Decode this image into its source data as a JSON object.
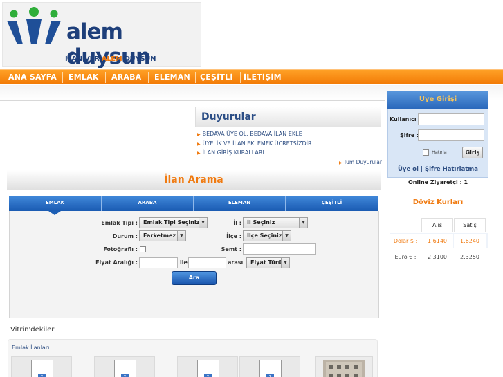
{
  "logo": {
    "word1": "alem",
    "word2": "duysun",
    "tagline_prefix": "ILAN VER ",
    "tagline_accent": "ALEM",
    "tagline_suffix": " DUYSUN"
  },
  "nav": [
    "ANA SAYFA",
    "EMLAK",
    "ARABA",
    "ELEMAN",
    "ÇEŞİTLİ",
    "İLETİŞİM"
  ],
  "announcements": {
    "title": "Duyurular",
    "items": [
      "BEDAVA ÜYE OL, BEDAVA İLAN EKLE",
      "ÜYELİK VE İLAN EKLEMEK ÜCRETSİZDİR...",
      "İLAN GİRİŞ KURALLARI"
    ],
    "all_link": "Tüm Duyurular"
  },
  "search": {
    "title": "İlan Arama",
    "tabs": [
      "EMLAK",
      "ARABA",
      "ELEMAN",
      "ÇEŞİTLİ"
    ],
    "active_tab": "EMLAK",
    "labels": {
      "emlak_tipi": "Emlak Tipi :",
      "durum": "Durum :",
      "fotografli": "Fotoğraflı :",
      "fiyat": "Fiyat Aralığı :",
      "il": "İl :",
      "ilce": "İlçe :",
      "semt": "Semt :",
      "ile": "ile",
      "arasi": "arası"
    },
    "values": {
      "emlak_tipi": "Emlak Tipi Seçiniz",
      "durum": "Farketmez",
      "il": "İl Seçiniz",
      "ilce": "İlçe Seçiniz",
      "fiyat_turu": "Fiyat Türü"
    },
    "button": "Ara"
  },
  "vitrin": {
    "title": "Vitrin'dekiler",
    "section": "Emlak İlanları"
  },
  "member": {
    "title": "Üye Girişi",
    "user_label": "Kullanıcı :",
    "pass_label": "Şifre :",
    "remember": "Hatırla",
    "login": "Giriş",
    "signup": "Üye ol",
    "separator": "|",
    "forgot": "Şifre Hatırlatma",
    "online": "Online Ziyaretçi : 1"
  },
  "currency": {
    "title": "Döviz Kurları",
    "headers": [
      "Alış",
      "Satış"
    ],
    "rows": [
      {
        "name": "Dolar $ :",
        "buy": "1.6140",
        "sell": "1.6240"
      },
      {
        "name": "Euro € :",
        "buy": "2.3100",
        "sell": "2.3250"
      }
    ]
  },
  "colors": {
    "accent_orange": "#f07a10",
    "brand_blue": "#1e3f7a",
    "tab_blue": "#1a5bb2"
  }
}
